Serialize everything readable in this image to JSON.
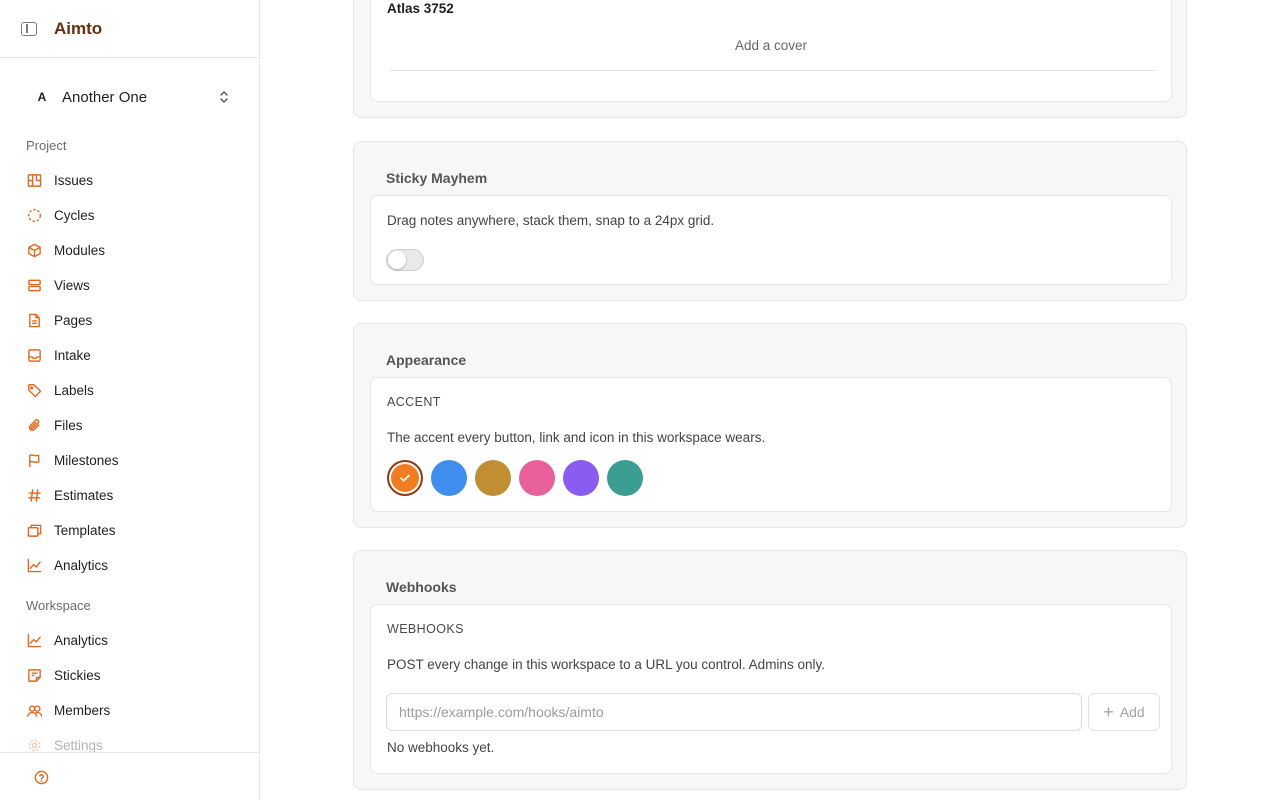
{
  "app": {
    "brand": "Aimto"
  },
  "project_switcher": {
    "avatar": "A",
    "name": "Another One"
  },
  "sidebar": {
    "project_label": "Project",
    "project_items": [
      {
        "label": "Issues",
        "icon": "board-icon"
      },
      {
        "label": "Cycles",
        "icon": "cycle-icon"
      },
      {
        "label": "Modules",
        "icon": "cube-icon"
      },
      {
        "label": "Views",
        "icon": "layers-icon"
      },
      {
        "label": "Pages",
        "icon": "page-icon"
      },
      {
        "label": "Intake",
        "icon": "inbox-icon"
      },
      {
        "label": "Labels",
        "icon": "tag-icon"
      },
      {
        "label": "Files",
        "icon": "paperclip-icon"
      },
      {
        "label": "Milestones",
        "icon": "flag-icon"
      },
      {
        "label": "Estimates",
        "icon": "hash-icon"
      },
      {
        "label": "Templates",
        "icon": "templates-icon"
      },
      {
        "label": "Analytics",
        "icon": "chart-icon"
      }
    ],
    "workspace_label": "Workspace",
    "workspace_items": [
      {
        "label": "Analytics",
        "icon": "chart-icon"
      },
      {
        "label": "Stickies",
        "icon": "sticky-note-icon"
      },
      {
        "label": "Members",
        "icon": "users-icon"
      },
      {
        "label": "Settings",
        "icon": "gear-icon"
      }
    ]
  },
  "main": {
    "cover_card": {
      "name": "Atlas 3752",
      "add_cover": "Add a cover"
    },
    "sticky_card": {
      "title": "Sticky Mayhem",
      "description": "Drag notes anywhere, stack them, snap to a 24px grid.",
      "toggle_on": false
    },
    "appearance_card": {
      "title": "Appearance",
      "caption": "ACCENT",
      "description": "The accent every button, link and icon in this workspace wears.",
      "swatches": [
        "#f07d24",
        "#3f8ded",
        "#c28e34",
        "#e8609c",
        "#8b5cf0",
        "#3c9e92"
      ],
      "selected_index": 0
    },
    "webhooks_card": {
      "title": "Webhooks",
      "caption": "WEBHOOKS",
      "description": "POST every change in this workspace to a URL you control. Admins only.",
      "url_placeholder": "https://example.com/hooks/aimto",
      "add_label": "Add",
      "empty_text": "No webhooks yet."
    }
  },
  "colors": {
    "accent": "#e0691d",
    "brand": "#6b2d12"
  }
}
